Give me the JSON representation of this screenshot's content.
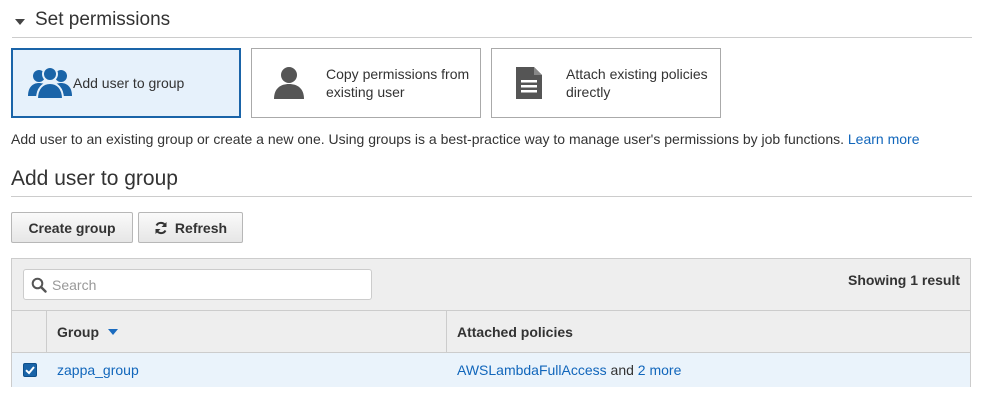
{
  "set_permissions": {
    "title": "Set permissions",
    "options": [
      {
        "label": "Add user to group",
        "icon": "user-group-icon",
        "selected": true
      },
      {
        "label": "Copy permissions from existing user",
        "icon": "single-user-icon",
        "selected": false
      },
      {
        "label": "Attach existing policies directly",
        "icon": "document-icon",
        "selected": false
      }
    ],
    "description": "Add user to an existing group or create a new one. Using groups is a best-practice way to manage user's permissions by job functions.",
    "learn_more": "Learn more"
  },
  "add_user_to_group": {
    "title": "Add user to group",
    "create_group_label": "Create group",
    "refresh_label": "Refresh"
  },
  "table": {
    "search": {
      "placeholder": "Search",
      "value": ""
    },
    "result_count": "Showing 1 result",
    "columns": {
      "group": "Group",
      "attached_policies": "Attached policies"
    },
    "rows": [
      {
        "checked": true,
        "group": "zappa_group",
        "policy_link": "AWSLambdaFullAccess",
        "policy_joiner": "and",
        "more_link": "2 more"
      }
    ]
  },
  "colors": {
    "accent": "#1a64a8",
    "link": "#1166bb",
    "selected_bg": "#e6f1fb",
    "row_selected_bg": "#eaf3fb"
  }
}
